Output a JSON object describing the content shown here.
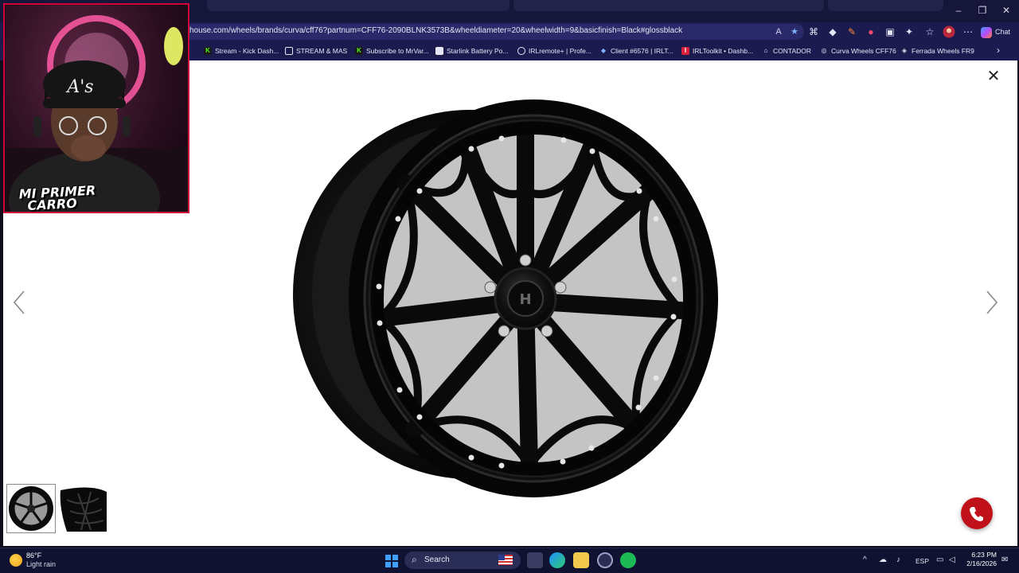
{
  "browser": {
    "url": "house.com/wheels/brands/curva/cff76?partnum=CFF76-2090BLNK3573B&wheeldiameter=20&wheelwidth=9&basicfinish=Black#glossblack",
    "bookmarks": [
      {
        "label": "Stream - Kick Dash...",
        "icon": "kick-icon"
      },
      {
        "label": "STREAM & MAS",
        "icon": "folder-icon"
      },
      {
        "label": "Subscribe to MrVar...",
        "icon": "kick-icon"
      },
      {
        "label": "Starlink Battery Po...",
        "icon": "page-icon"
      },
      {
        "label": "IRLremote+ | Profe...",
        "icon": "globe-icon"
      },
      {
        "label": "Client #6576 | IRLT...",
        "icon": "client-icon"
      },
      {
        "label": "IRLToolkit • Dashb...",
        "icon": "irltoolkit-icon"
      },
      {
        "label": "CONTADOR",
        "icon": "contador-icon"
      },
      {
        "label": "Curva Wheels CFF76",
        "icon": "curva-icon"
      },
      {
        "label": "Ferrada Wheels FR9",
        "icon": "ferrada-icon"
      }
    ],
    "chat_label": "Chat"
  },
  "webcam": {
    "overlay_text_line1": "MI PRIMER",
    "overlay_text_line2": "CARRO"
  },
  "gallery": {
    "thumbnail_count": 2,
    "selected_index": 0
  },
  "taskbar": {
    "temperature": "86°F",
    "condition": "Light rain",
    "search_label": "Search",
    "language": "ESP",
    "time": "6:23 PM",
    "date": "2/16/2026"
  },
  "colors": {
    "browser_chrome": "#1b1b50",
    "call_button": "#c0101a",
    "webcam_border": "#d0003a"
  }
}
